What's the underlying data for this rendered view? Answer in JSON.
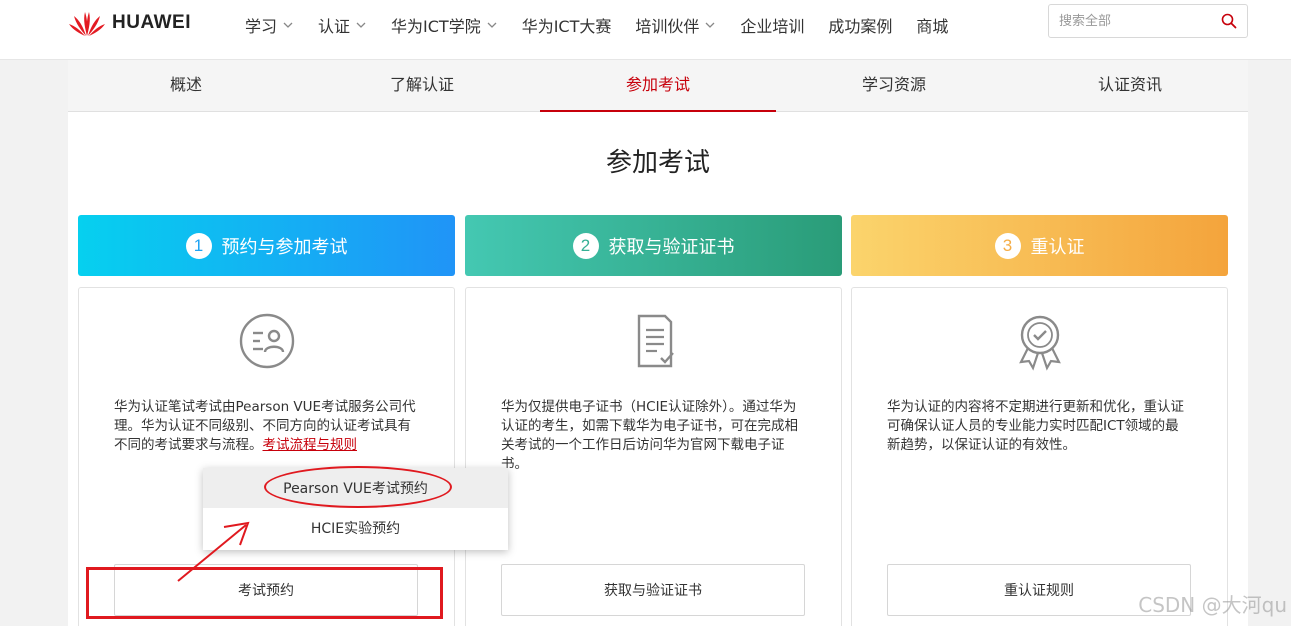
{
  "brand": {
    "name": "HUAWEI",
    "accent": "#c7000b"
  },
  "nav": {
    "items": [
      {
        "label": "学习",
        "dropdown": true
      },
      {
        "label": "认证",
        "dropdown": true
      },
      {
        "label": "华为ICT学院",
        "dropdown": true
      },
      {
        "label": "华为ICT大赛",
        "dropdown": false
      },
      {
        "label": "培训伙伴",
        "dropdown": true
      },
      {
        "label": "企业培训",
        "dropdown": false
      },
      {
        "label": "成功案例",
        "dropdown": false
      },
      {
        "label": "商城",
        "dropdown": false
      }
    ],
    "search_placeholder": "搜索全部"
  },
  "subtabs": {
    "items": [
      "概述",
      "了解认证",
      "参加考试",
      "学习资源",
      "认证资讯"
    ],
    "active": "参加考试"
  },
  "page": {
    "title": "参加考试"
  },
  "steps": [
    {
      "num": "1",
      "label": "预约与参加考试",
      "icon": "exam-user-icon",
      "text": "华为认证笔试考试由Pearson VUE考试服务公司代理。华为认证不同级别、不同方向的认证考试具有不同的考试要求与流程。",
      "link": "考试流程与规则",
      "button": "考试预约"
    },
    {
      "num": "2",
      "label": "获取与验证证书",
      "icon": "certificate-document-icon",
      "text": "华为仅提供电子证书（HCIE认证除外）。通过华为认证的考生，如需下载华为电子证书，可在完成相关考试的一个工作日后访问华为官网下载电子证书。",
      "button": "获取与验证证书"
    },
    {
      "num": "3",
      "label": "重认证",
      "icon": "badge-check-icon",
      "text": "华为认证的内容将不定期进行更新和优化，重认证可确保认证人员的专业能力实时匹配ICT领域的最新趋势，以保证认证的有效性。",
      "button": "重认证规则"
    }
  ],
  "booking_menu": {
    "items": [
      "Pearson VUE考试预约",
      "HCIE实验预约"
    ],
    "hovered": "Pearson VUE考试预约"
  },
  "watermark": "CSDN @大河qu"
}
